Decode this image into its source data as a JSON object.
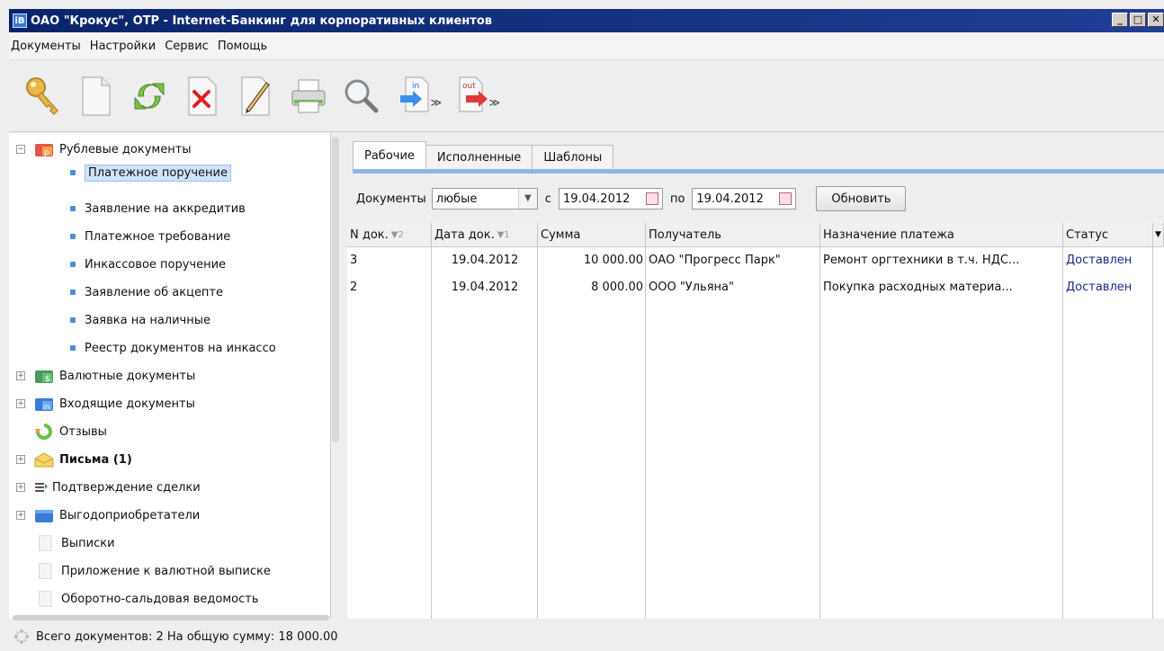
{
  "window": {
    "title": "ОАО \"Крокус\", ОТР - Internet-Банкинг для корпоративных клиентов",
    "app_icon_text": "iB"
  },
  "menu": [
    "Документы",
    "Настройки",
    "Сервис",
    "Помощь"
  ],
  "toolbar": {
    "buttons": [
      "key-icon",
      "new-document-icon",
      "refresh-icon",
      "delete-icon",
      "edit-icon",
      "print-icon",
      "search-icon",
      "import-icon",
      "export-icon"
    ],
    "import_label": "in",
    "export_label": "out"
  },
  "tree": {
    "rub_docs": "Рублевые документы",
    "rub_children": [
      "Платежное поручение",
      "Заявление на аккредитив",
      "Платежное требование",
      "Инкассовое поручение",
      "Заявление об акцепте",
      "Заявка на наличные",
      "Реестр документов на инкассо"
    ],
    "currency_docs": "Валютные документы",
    "incoming_docs": "Входящие документы",
    "feedback": "Отзывы",
    "letters": "Письма (1)",
    "deal_confirm": "Подтверждение сделки",
    "beneficiaries": "Выгодоприобретатели",
    "statements": "Выписки",
    "currency_statement_app": "Приложение к валютной выписке",
    "turnover": "Оборотно-сальдовая ведомость",
    "icon_letters": {
      "rub": "р",
      "cur": "$",
      "in": "in"
    }
  },
  "tabs": [
    "Рабочие",
    "Исполненные",
    "Шаблоны"
  ],
  "filter": {
    "docs_label": "Документы",
    "docs_value": "любые",
    "from_label": "с",
    "from_date": "19.04.2012",
    "to_label": "по",
    "to_date": "19.04.2012",
    "refresh_label": "Обновить"
  },
  "grid": {
    "headers": [
      {
        "label": "N док.",
        "sort": "▼2"
      },
      {
        "label": "Дата док.",
        "sort": "▼1"
      },
      {
        "label": "Сумма",
        "sort": ""
      },
      {
        "label": "Получатель",
        "sort": ""
      },
      {
        "label": "Назначение платежа",
        "sort": ""
      },
      {
        "label": "Статус",
        "sort": ""
      }
    ],
    "rows": [
      [
        "3",
        "19.04.2012",
        "10 000.00",
        "ОАО \"Прогресс Парк\"",
        "Ремонт оргтехники в т.ч. НДС...",
        "Доставлен"
      ],
      [
        "2",
        "19.04.2012",
        "8 000.00",
        "ООО \"Ульяна\"",
        "Покупка расходных материа...",
        "Доставлен"
      ]
    ]
  },
  "statusbar": {
    "text": "Всего документов: 2 На общую сумму: 18 000.00"
  },
  "colors": {
    "titlebar": "#0a246a",
    "accent": "#8ab8e8",
    "selection": "#cfe3fb",
    "status_link": "#1a2a8a"
  }
}
